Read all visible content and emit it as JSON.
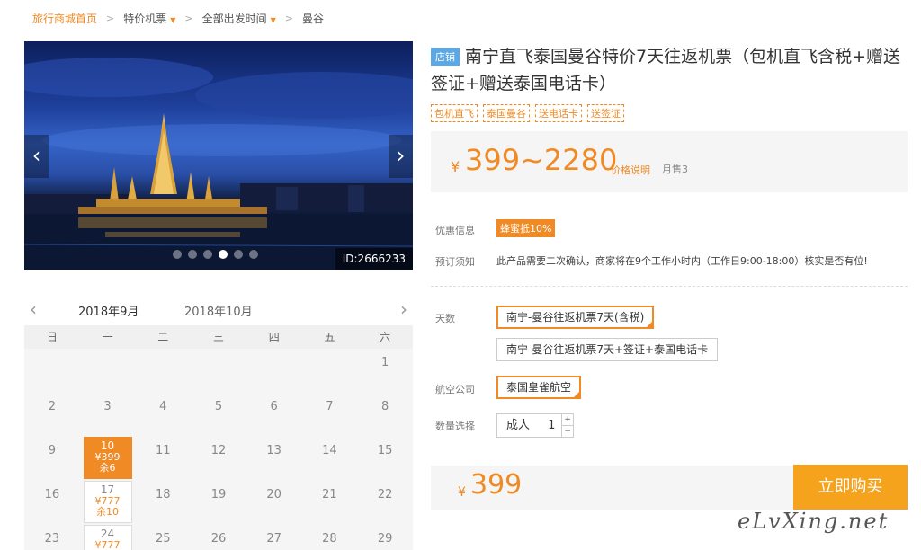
{
  "breadcrumb": {
    "home": "旅行商城首页",
    "item1": "特价机票",
    "item2": "全部出发时间",
    "item3": "曼谷"
  },
  "gallery": {
    "id_label": "ID:2666233",
    "slide_count": 6,
    "active_slide": 4
  },
  "calendar": {
    "month_tabs": [
      "2018年9月",
      "2018年10月"
    ],
    "weekdays": [
      "日",
      "一",
      "二",
      "三",
      "四",
      "五",
      "六"
    ],
    "rows": [
      [
        "",
        "",
        "",
        "",
        "",
        "",
        "1"
      ],
      [
        "2",
        "3",
        "4",
        "5",
        "6",
        "7",
        "8"
      ],
      [
        "9",
        "10",
        "11",
        "12",
        "13",
        "14",
        "15"
      ],
      [
        "16",
        "17",
        "18",
        "19",
        "20",
        "21",
        "22"
      ],
      [
        "23",
        "24",
        "25",
        "26",
        "27",
        "28",
        "29"
      ]
    ],
    "priced": {
      "10": {
        "price": "¥399",
        "remain": "余6",
        "selected": true
      },
      "17": {
        "price": "¥777",
        "remain": "余10",
        "selected": false
      },
      "24": {
        "price": "¥777",
        "remain": "",
        "selected": false
      }
    }
  },
  "product": {
    "shop_tag": "店铺",
    "title": "南宁直飞泰国曼谷特价7天往返机票（包机直飞含税+赠送签证+赠送泰国电话卡）",
    "tags": [
      "包机直飞",
      "泰国曼谷",
      "送电话卡",
      "送签证"
    ],
    "currency": "¥",
    "price_range": "399~2280",
    "price_explain": "价格说明",
    "monthly_sales": "月售3",
    "promo_label": "优惠信息",
    "promo_value": "蜂蜜抵10%",
    "notice_label": "预订须知",
    "notice_text": "此产品需要二次确认，商家将在9个工作小时内（工作日9:00-18:00）核实是否有位!"
  },
  "options": {
    "days_label": "天数",
    "days": [
      "南宁-曼谷往返机票7天(含税)",
      "南宁-曼谷往返机票7天+签证+泰国电话卡"
    ],
    "airline_label": "航空公司",
    "airline": "泰国皇雀航空",
    "qty_label": "数量选择",
    "qty_type": "成人",
    "qty_value": "1",
    "plus": "+",
    "minus": "−"
  },
  "buy": {
    "currency": "¥",
    "total": "399",
    "button": "立即购买"
  },
  "watermark": "eLvXing.net",
  "colors": {
    "accent": "#f08a24",
    "blue_tag": "#5ba8e6",
    "buy_button": "#f5a21c"
  }
}
